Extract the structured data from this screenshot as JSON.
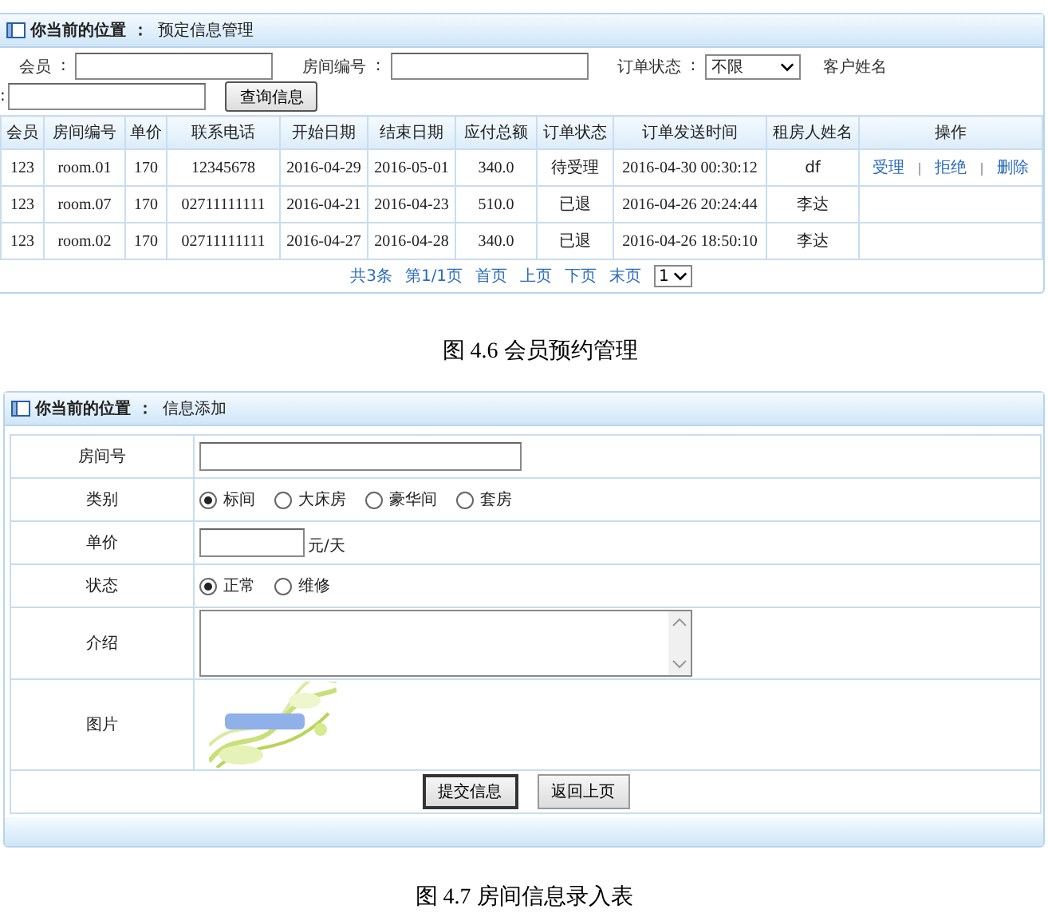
{
  "reservation_panel": {
    "location_label": "你当前的位置",
    "location_colon": "：",
    "location_value": "预定信息管理",
    "filter_rows": [
      [
        {
          "kind": "text",
          "label": "会员",
          "colon": ":"
        },
        {
          "kind": "text",
          "label": "房间编号",
          "colon": ":"
        },
        {
          "kind": "select",
          "label": "订单状态",
          "colon": ":",
          "value": "不限"
        },
        {
          "kind": "label",
          "label": "客户姓名"
        }
      ],
      [
        {
          "kind": "text",
          "colon": ":"
        },
        {
          "kind": "button",
          "label": "查询信息"
        }
      ]
    ],
    "columns": [
      "会员",
      "房间编号",
      "单价",
      "联系电话",
      "开始日期",
      "结束日期",
      "应付总额",
      "订单状态",
      "订单发送时间",
      "租房人姓名",
      "操作"
    ],
    "rows": [
      {
        "cells": [
          "123",
          "room.01",
          "170",
          "12345678",
          "2016-04-29",
          "2016-05-01",
          "340.0",
          "待受理",
          "2016-04-30 00:30:12",
          "df"
        ],
        "actions": [
          "受理",
          "拒绝",
          "删除"
        ]
      },
      {
        "cells": [
          "123",
          "room.07",
          "170",
          "02711111111",
          "2016-04-21",
          "2016-04-23",
          "510.0",
          "已退",
          "2016-04-26 20:24:44",
          "李达"
        ],
        "actions": []
      },
      {
        "cells": [
          "123",
          "room.02",
          "170",
          "02711111111",
          "2016-04-27",
          "2016-04-28",
          "340.0",
          "已退",
          "2016-04-26 18:50:10",
          "李达"
        ],
        "actions": []
      }
    ],
    "pager": {
      "total": "共3条",
      "page": "第1/1页",
      "links": [
        "首页",
        "上页",
        "下页",
        "末页"
      ],
      "page_select": "1"
    }
  },
  "caption_1": "图 4.6  会员预约管理",
  "room_panel": {
    "location_label": "你当前的位置",
    "location_colon": "：",
    "location_value": "信息添加",
    "fields": [
      {
        "kind": "text",
        "label": "房间号"
      },
      {
        "kind": "radio",
        "label": "类别",
        "options": [
          {
            "label": "标间",
            "selected": true
          },
          {
            "label": "大床房",
            "selected": false
          },
          {
            "label": "豪华间",
            "selected": false
          },
          {
            "label": "套房",
            "selected": false
          }
        ]
      },
      {
        "kind": "price",
        "label": "单价",
        "unit": "元/天"
      },
      {
        "kind": "radio",
        "label": "状态",
        "options": [
          {
            "label": "正常",
            "selected": true
          },
          {
            "label": "维修",
            "selected": false
          }
        ]
      },
      {
        "kind": "textarea",
        "label": "介绍"
      },
      {
        "kind": "picture",
        "label": "图片"
      }
    ],
    "buttons": [
      "提交信息",
      "返回上页"
    ]
  },
  "caption_2": "图 4.7  房间信息录入表"
}
